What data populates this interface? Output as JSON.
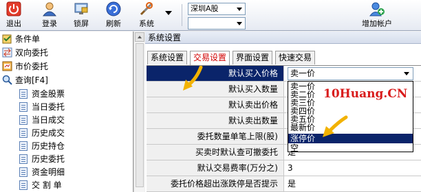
{
  "toolbar": {
    "buttons": [
      {
        "label": "退出",
        "icon": "power-icon"
      },
      {
        "label": "登录",
        "icon": "user-icon"
      },
      {
        "label": "锁屏",
        "icon": "lock-screen-icon"
      },
      {
        "label": "刷新",
        "icon": "refresh-icon"
      },
      {
        "label": "系统",
        "icon": "tools-icon"
      }
    ],
    "market_combo": "深圳A股",
    "second_combo": "",
    "add_account_label": "增加帐户"
  },
  "tree": {
    "items": [
      {
        "label": "条件单"
      },
      {
        "label": "双向委托"
      },
      {
        "label": "市价委托"
      },
      {
        "label": "查询[F4]"
      },
      {
        "label": "资金股票"
      },
      {
        "label": "当日委托"
      },
      {
        "label": "当日成交"
      },
      {
        "label": "历史成交"
      },
      {
        "label": "历史持仓"
      },
      {
        "label": "历史委托"
      },
      {
        "label": "资金明细"
      },
      {
        "label": "交 割 单"
      }
    ]
  },
  "panel": {
    "title": "系统设置",
    "tabs": [
      "系统设置",
      "交易设置",
      "界面设置",
      "快速交易"
    ],
    "active_tab": 1,
    "rows": [
      {
        "name": "默认买入价格",
        "value": "卖一价"
      },
      {
        "name": "默认买入数量",
        "value": ""
      },
      {
        "name": "默认卖出价格",
        "value": ""
      },
      {
        "name": "默认卖出数量",
        "value": ""
      },
      {
        "name": "委托数量单笔上限(股)",
        "value": ""
      },
      {
        "name": "买卖时默认查可撤委托",
        "value": "是"
      },
      {
        "name": "默认交易费率(万分之)",
        "value": "3"
      },
      {
        "name": "委托价格超出涨跌停是否提示",
        "value": "是"
      }
    ],
    "dropdown_options": [
      "卖一价",
      "卖二价",
      "卖三价",
      "卖四价",
      "卖五价",
      "最新价",
      "涨停价",
      "空"
    ],
    "highlighted_option": 6
  },
  "watermark": "10Huang.CN",
  "colors": {
    "accent_red": "#d00000",
    "selection": "#0a246a",
    "arrow": "#f2b200"
  }
}
